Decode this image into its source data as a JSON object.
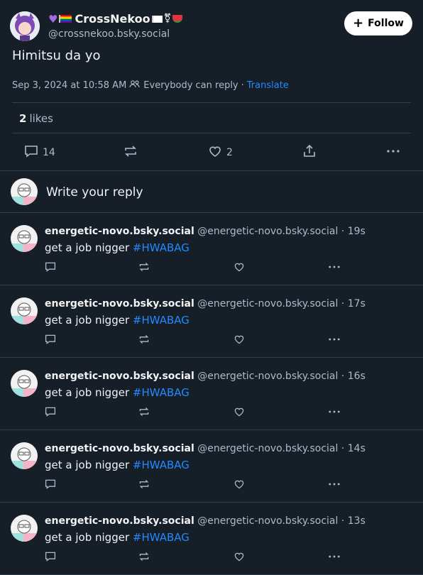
{
  "post": {
    "author_name": "CrossNekoo",
    "author_handle": "@crossnekoo.bsky.social",
    "follow_label": "Follow",
    "text": "Himitsu da yo",
    "date": "Sep 3, 2024 at 10:58 AM",
    "reply_setting": "Everybody can reply",
    "separator": "·",
    "translate": "Translate",
    "likes_count": "2",
    "likes_label": "likes",
    "reply_count": "14",
    "like_count": "2"
  },
  "reply_box": {
    "prompt": "Write your reply"
  },
  "replies": [
    {
      "name": "energetic-novo.bsky.social",
      "handle": "@energetic-novo.bsky.social",
      "time": "19s",
      "text": "get a job nigger",
      "tag": "#HWABAG"
    },
    {
      "name": "energetic-novo.bsky.social",
      "handle": "@energetic-novo.bsky.social",
      "time": "17s",
      "text": "get a job nigger",
      "tag": "#HWABAG"
    },
    {
      "name": "energetic-novo.bsky.social",
      "handle": "@energetic-novo.bsky.social",
      "time": "16s",
      "text": "get a job nigger",
      "tag": "#HWABAG"
    },
    {
      "name": "energetic-novo.bsky.social",
      "handle": "@energetic-novo.bsky.social",
      "time": "14s",
      "text": "get a job nigger",
      "tag": "#HWABAG"
    },
    {
      "name": "energetic-novo.bsky.social",
      "handle": "@energetic-novo.bsky.social",
      "time": "13s",
      "text": "get a job nigger",
      "tag": "#HWABAG"
    }
  ],
  "colors": {
    "background": "#161e27",
    "accent": "#208bfe",
    "muted": "#aebbc9",
    "divider": "#2e4052"
  }
}
